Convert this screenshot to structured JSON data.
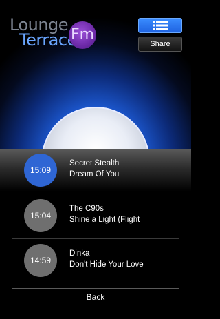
{
  "header": {
    "logo_word_1": "Lounge",
    "logo_word_2": "Terrace",
    "logo_badge": "Fm",
    "list_button_icon": "list-icon",
    "share_label": "Share"
  },
  "playlist": [
    {
      "time": "15:09",
      "artist": "Secret Stealth",
      "title": "Dream Of You",
      "state": "current"
    },
    {
      "time": "15:04",
      "artist": "The C90s",
      "title": "Shine a Light (Flight",
      "state": "past"
    },
    {
      "time": "14:59",
      "artist": "Dinka",
      "title": "Don't Hide Your Love",
      "state": "past"
    }
  ],
  "footer": {
    "back_label": "Back"
  },
  "colors": {
    "accent_blue": "#2f66d4",
    "past_gray": "#6f6f6f",
    "logo_purple": "#6d2aa8"
  }
}
